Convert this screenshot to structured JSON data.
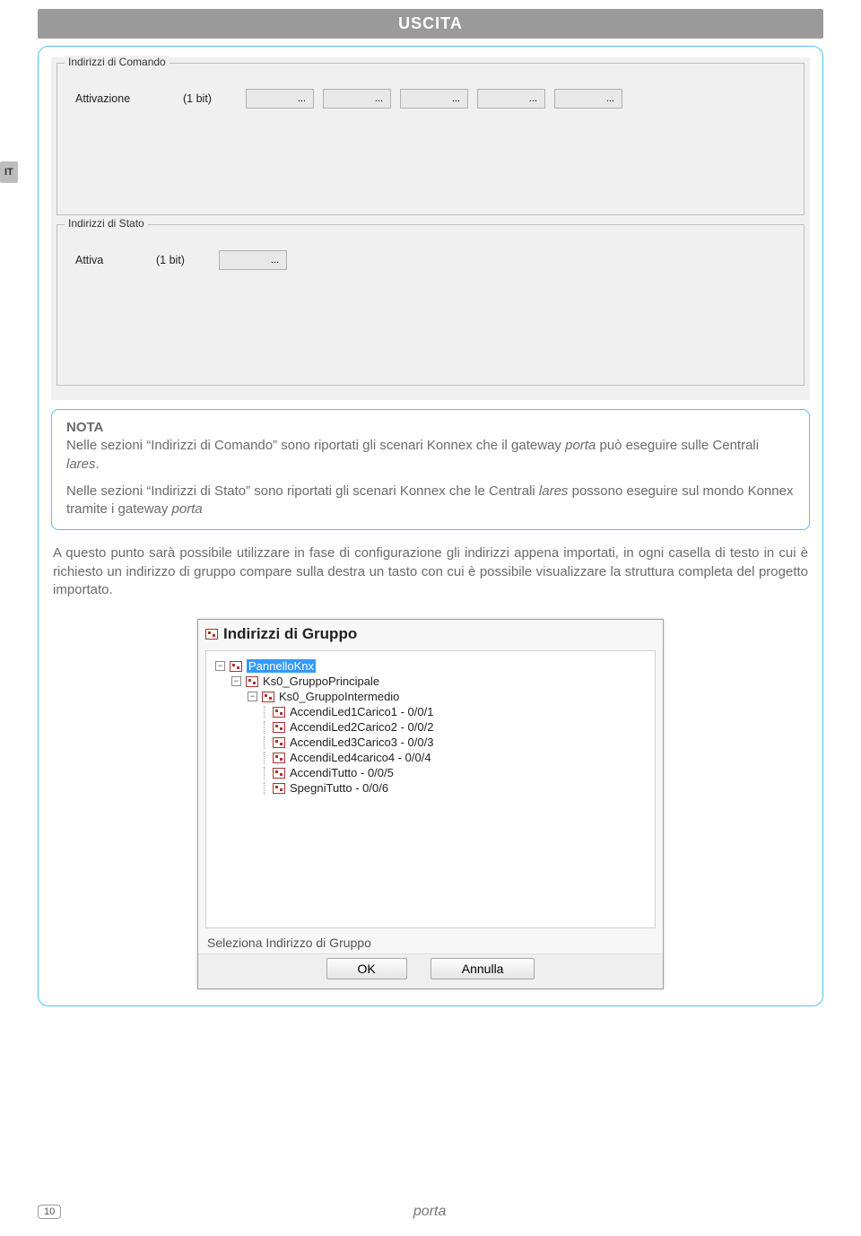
{
  "header": {
    "title": "USCITA"
  },
  "sideTab": "IT",
  "panel1": {
    "legend": "Indirizzi di Comando",
    "rowLabel": "Attivazione",
    "rowBits": "(1 bit)",
    "btn": "..."
  },
  "panel2": {
    "legend": "Indirizzi di Stato",
    "rowLabel": "Attiva",
    "rowBits": "(1 bit)",
    "btn": "..."
  },
  "nota": {
    "title": "NOTA",
    "p1a": "Nelle sezioni “Indirizzi di Comando” sono riportati gli scenari Konnex che il gateway ",
    "p1i1": "porta",
    "p1b": " può eseguire sulle Centrali ",
    "p1i2": "lares",
    "p1c": ".",
    "p2a": "Nelle sezioni “Indirizzi di Stato” sono riportati gli scenari Konnex che le Centrali ",
    "p2i1": "lares",
    "p2b": " possono eseguire sul mondo Konnex tramite i gateway ",
    "p2i2": "porta"
  },
  "bodyText": "A questo punto sarà possibile utilizzare in fase di configurazione gli indirizzi appena importati, in ogni casella di testo in cui è richiesto un indirizzo di gruppo compare sulla destra un tasto con cui è possibile visualizzare la struttura completa del progetto importato.",
  "dialog": {
    "title": "Indirizzi di Gruppo",
    "tree": {
      "root": "PannelloKnx",
      "l1": "Ks0_GruppoPrincipale",
      "l2": "Ks0_GruppoIntermedio",
      "items": [
        "AccendiLed1Carico1 - 0/0/1",
        "AccendiLed2Carico2 - 0/0/2",
        "AccendiLed3Carico3 - 0/0/3",
        "AccendiLed4carico4 - 0/0/4",
        "AccendiTutto - 0/0/5",
        "SpegniTutto - 0/0/6"
      ]
    },
    "footerLabel": "Seleziona Indirizzo di Gruppo",
    "ok": "OK",
    "cancel": "Annulla"
  },
  "footer": {
    "pageNum": "10",
    "center": "porta"
  }
}
